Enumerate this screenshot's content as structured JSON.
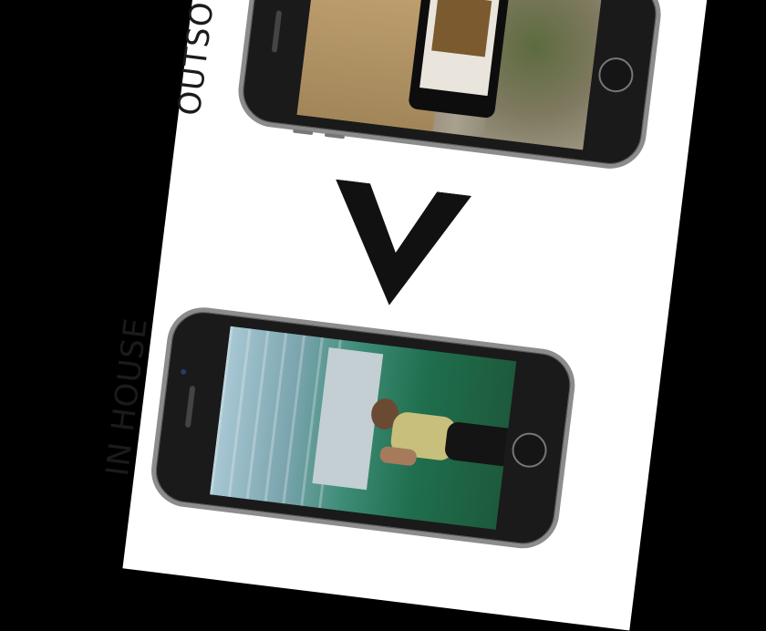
{
  "labels": {
    "top": "OUTSOURC",
    "bottom": "IN HOUSE"
  },
  "icons": {
    "arrow": "chevron-down-icon"
  },
  "colors": {
    "background": "#000000",
    "sheet": "#ffffff",
    "text": "#1b1b1b",
    "chevron": "#111111"
  }
}
